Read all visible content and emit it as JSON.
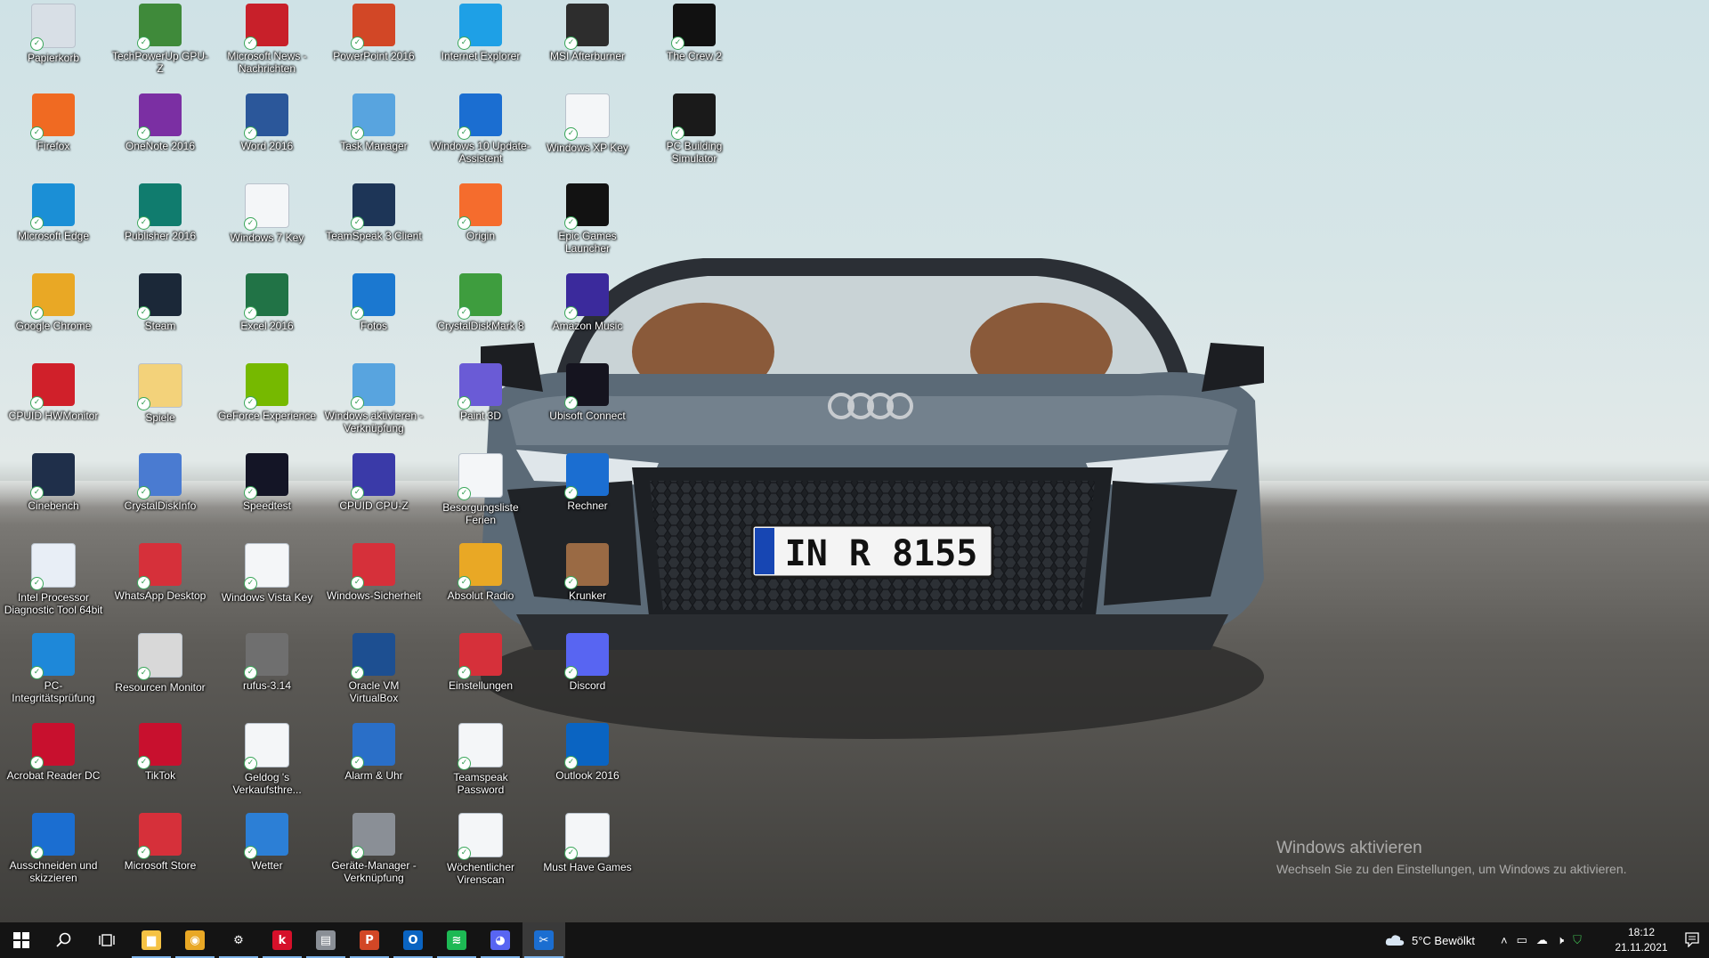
{
  "desktop": {
    "columns": [
      [
        {
          "label": "Papierkorb",
          "icon": "recycle-bin-icon",
          "color": "#d8dfe6"
        },
        {
          "label": "Firefox",
          "icon": "firefox-icon",
          "color": "#f06a22"
        },
        {
          "label": "Microsoft Edge",
          "icon": "edge-icon",
          "color": "#1b8fd6"
        },
        {
          "label": "Google Chrome",
          "icon": "chrome-icon",
          "color": "#e9a825"
        },
        {
          "label": "CPUID HWMonitor",
          "icon": "hwmonitor-icon",
          "color": "#d0202a"
        },
        {
          "label": "Cinebench",
          "icon": "cinebench-icon",
          "color": "#1f2f4a"
        },
        {
          "label": "Intel Processor Diagnostic Tool 64bit",
          "icon": "document-icon",
          "color": "#e8eef6"
        },
        {
          "label": "PC-Integritätsprüfung",
          "icon": "pc-health-icon",
          "color": "#1e88d9"
        },
        {
          "label": "Acrobat Reader DC",
          "icon": "acrobat-icon",
          "color": "#c8102e"
        },
        {
          "label": "Ausschneiden und skizzieren",
          "icon": "snip-sketch-icon",
          "color": "#1b6ed1"
        }
      ],
      [
        {
          "label": "TechPowerUp GPU-Z",
          "icon": "gpuz-icon",
          "color": "#3f8a3a"
        },
        {
          "label": "OneNote 2016",
          "icon": "onenote-icon",
          "color": "#7b2fa3"
        },
        {
          "label": "Publisher 2016",
          "icon": "publisher-icon",
          "color": "#107c6e"
        },
        {
          "label": "Steam",
          "icon": "steam-icon",
          "color": "#1b2838"
        },
        {
          "label": "Spiele",
          "icon": "folder-games-icon",
          "color": "#f3d27a"
        },
        {
          "label": "CrystalDiskInfo",
          "icon": "crystaldiskinfo-icon",
          "color": "#4a7bd1"
        },
        {
          "label": "WhatsApp Desktop",
          "icon": "whatsapp-icon",
          "color": "#d6303a"
        },
        {
          "label": "Resourcen Monitor",
          "icon": "resource-monitor-icon",
          "color": "#d8d8d8"
        },
        {
          "label": "TikTok",
          "icon": "tiktok-icon",
          "color": "#c8102e"
        },
        {
          "label": "Microsoft Store",
          "icon": "store-icon",
          "color": "#d6303a"
        }
      ],
      [
        {
          "label": "Microsoft News - Nachrichten",
          "icon": "news-icon",
          "color": "#c8202a"
        },
        {
          "label": "Word 2016",
          "icon": "word-icon",
          "color": "#2b579a"
        },
        {
          "label": "Windows 7 Key",
          "icon": "blank-file-icon",
          "color": "#f4f6f8"
        },
        {
          "label": "Excel 2016",
          "icon": "excel-icon",
          "color": "#217346"
        },
        {
          "label": "GeForce Experience",
          "icon": "geforce-icon",
          "color": "#76b900"
        },
        {
          "label": "Speedtest",
          "icon": "speedtest-icon",
          "color": "#141526"
        },
        {
          "label": "Windows Vista Key",
          "icon": "blank-file-icon",
          "color": "#f4f6f8"
        },
        {
          "label": "rufus-3.14",
          "icon": "rufus-icon",
          "color": "#6f6f6f"
        },
        {
          "label": "Geldog 's Verkaufsthre...",
          "icon": "word-document-icon",
          "color": "#f4f6f8"
        },
        {
          "label": "Wetter",
          "icon": "weather-icon",
          "color": "#2c7fd6"
        }
      ],
      [
        {
          "label": "PowerPoint 2016",
          "icon": "powerpoint-icon",
          "color": "#d24726"
        },
        {
          "label": "Task Manager",
          "icon": "task-manager-icon",
          "color": "#58a4df"
        },
        {
          "label": "TeamSpeak 3 Client",
          "icon": "teamspeak-icon",
          "color": "#1d3557"
        },
        {
          "label": "Fotos",
          "icon": "photos-icon",
          "color": "#1b78d0"
        },
        {
          "label": "Windows aktivieren - Verknüpfung",
          "icon": "monitor-shortcut-icon",
          "color": "#58a4df"
        },
        {
          "label": "CPUID CPU-Z",
          "icon": "cpuz-icon",
          "color": "#3a3aa8"
        },
        {
          "label": "Windows-Sicherheit",
          "icon": "security-shield-icon",
          "color": "#d6303a"
        },
        {
          "label": "Oracle VM VirtualBox",
          "icon": "virtualbox-icon",
          "color": "#1d4f91"
        },
        {
          "label": "Alarm & Uhr",
          "icon": "alarm-clock-icon",
          "color": "#2a6fc8"
        },
        {
          "label": "Geräte-Manager - Verknüpfung",
          "icon": "device-manager-icon",
          "color": "#8a8f96"
        }
      ],
      [
        {
          "label": "Internet Explorer",
          "icon": "internet-explorer-icon",
          "color": "#1ea0e6"
        },
        {
          "label": "Windows 10 Update-Assistent",
          "icon": "update-assistant-icon",
          "color": "#1b6ed1"
        },
        {
          "label": "Origin",
          "icon": "origin-icon",
          "color": "#f56c2d"
        },
        {
          "label": "CrystalDiskMark 8",
          "icon": "crystaldiskmark-icon",
          "color": "#3e9d3e"
        },
        {
          "label": "Paint 3D",
          "icon": "paint3d-icon",
          "color": "#6a5bd6"
        },
        {
          "label": "Besorgungsliste Ferien",
          "icon": "word-document-icon",
          "color": "#f4f6f8"
        },
        {
          "label": "Absolut Radio",
          "icon": "chrome-icon",
          "color": "#e9a825"
        },
        {
          "label": "Einstellungen",
          "icon": "gear-icon",
          "color": "#d6303a"
        },
        {
          "label": "Teamspeak Password",
          "icon": "blank-file-icon",
          "color": "#f4f6f8"
        },
        {
          "label": "Wöchentlicher Virenscan",
          "icon": "blank-file-icon",
          "color": "#f4f6f8"
        }
      ],
      [
        {
          "label": "MSI Afterburner",
          "icon": "afterburner-icon",
          "color": "#2d2d2d"
        },
        {
          "label": "Windows XP Key",
          "icon": "blank-file-icon",
          "color": "#f4f6f8"
        },
        {
          "label": "Epic Games Launcher",
          "icon": "epic-games-icon",
          "color": "#121212"
        },
        {
          "label": "Amazon Music",
          "icon": "amazon-music-icon",
          "color": "#3b2a9c"
        },
        {
          "label": "Ubisoft Connect",
          "icon": "ubisoft-icon",
          "color": "#15141f"
        },
        {
          "label": "Rechner",
          "icon": "calculator-icon",
          "color": "#1b6ed1"
        },
        {
          "label": "Krunker",
          "icon": "krunker-icon",
          "color": "#9a6a44"
        },
        {
          "label": "Discord",
          "icon": "discord-icon",
          "color": "#5865f2"
        },
        {
          "label": "Outlook 2016",
          "icon": "outlook-icon",
          "color": "#0a64c2"
        },
        {
          "label": "Must Have Games",
          "icon": "text-file-icon",
          "color": "#f4f6f8"
        }
      ],
      [
        {
          "label": "The Crew 2",
          "icon": "the-crew-icon",
          "color": "#111111"
        },
        {
          "label": "PC Building Simulator",
          "icon": "pc-building-sim-icon",
          "color": "#1a1a1a"
        }
      ]
    ]
  },
  "wallpaper": {
    "plate": "IN R 8155"
  },
  "watermark": {
    "title": "Windows aktivieren",
    "subtitle": "Wechseln Sie zu den Einstellungen, um Windows zu aktivieren."
  },
  "taskbar": {
    "pinned": [
      {
        "name": "file-explorer-icon",
        "color": "#f5c244",
        "glyph": "▆"
      },
      {
        "name": "chrome-icon",
        "color": "#e9a825",
        "glyph": "◉"
      },
      {
        "name": "gear-icon",
        "color": "#141414",
        "glyph": "⚙"
      },
      {
        "name": "kaspersky-icon",
        "color": "#d6102a",
        "glyph": "k"
      },
      {
        "name": "device-manager-icon",
        "color": "#8a8f96",
        "glyph": "▤"
      },
      {
        "name": "powerpoint-icon",
        "color": "#d24726",
        "glyph": "P"
      },
      {
        "name": "outlook-icon",
        "color": "#0a64c2",
        "glyph": "O"
      },
      {
        "name": "spotify-icon",
        "color": "#1db954",
        "glyph": "≋"
      },
      {
        "name": "discord-icon",
        "color": "#5865f2",
        "glyph": "◕"
      },
      {
        "name": "snip-sketch-icon",
        "color": "#1b6ed1",
        "glyph": "✂"
      }
    ],
    "weather": "5°C  Bewölkt",
    "time": "18:12",
    "date": "21.11.2021"
  }
}
